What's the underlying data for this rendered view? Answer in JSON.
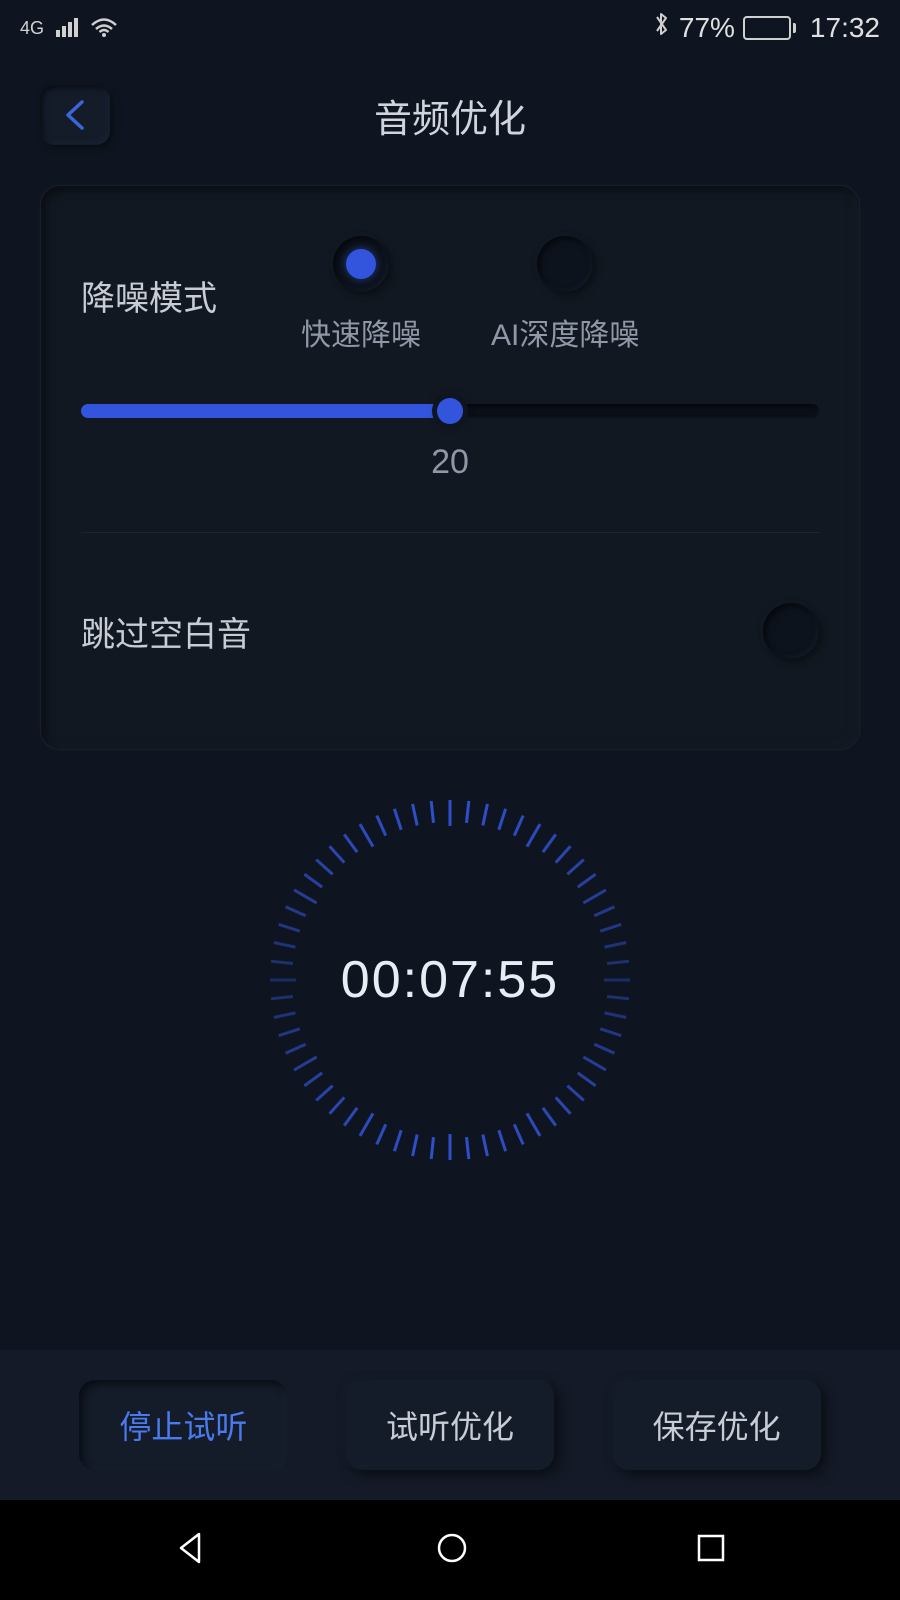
{
  "status": {
    "network": "4G",
    "battery_pct": "77%",
    "time": "17:32"
  },
  "header": {
    "title": "音频优化"
  },
  "noise": {
    "label": "降噪模式",
    "options": {
      "fast": "快速降噪",
      "ai": "AI深度降噪"
    },
    "slider_value": "20"
  },
  "skip": {
    "label": "跳过空白音"
  },
  "timer": {
    "value": "00:07:55"
  },
  "actions": {
    "stop_preview": "停止试听",
    "preview_optimize": "试听优化",
    "save_optimize": "保存优化"
  }
}
